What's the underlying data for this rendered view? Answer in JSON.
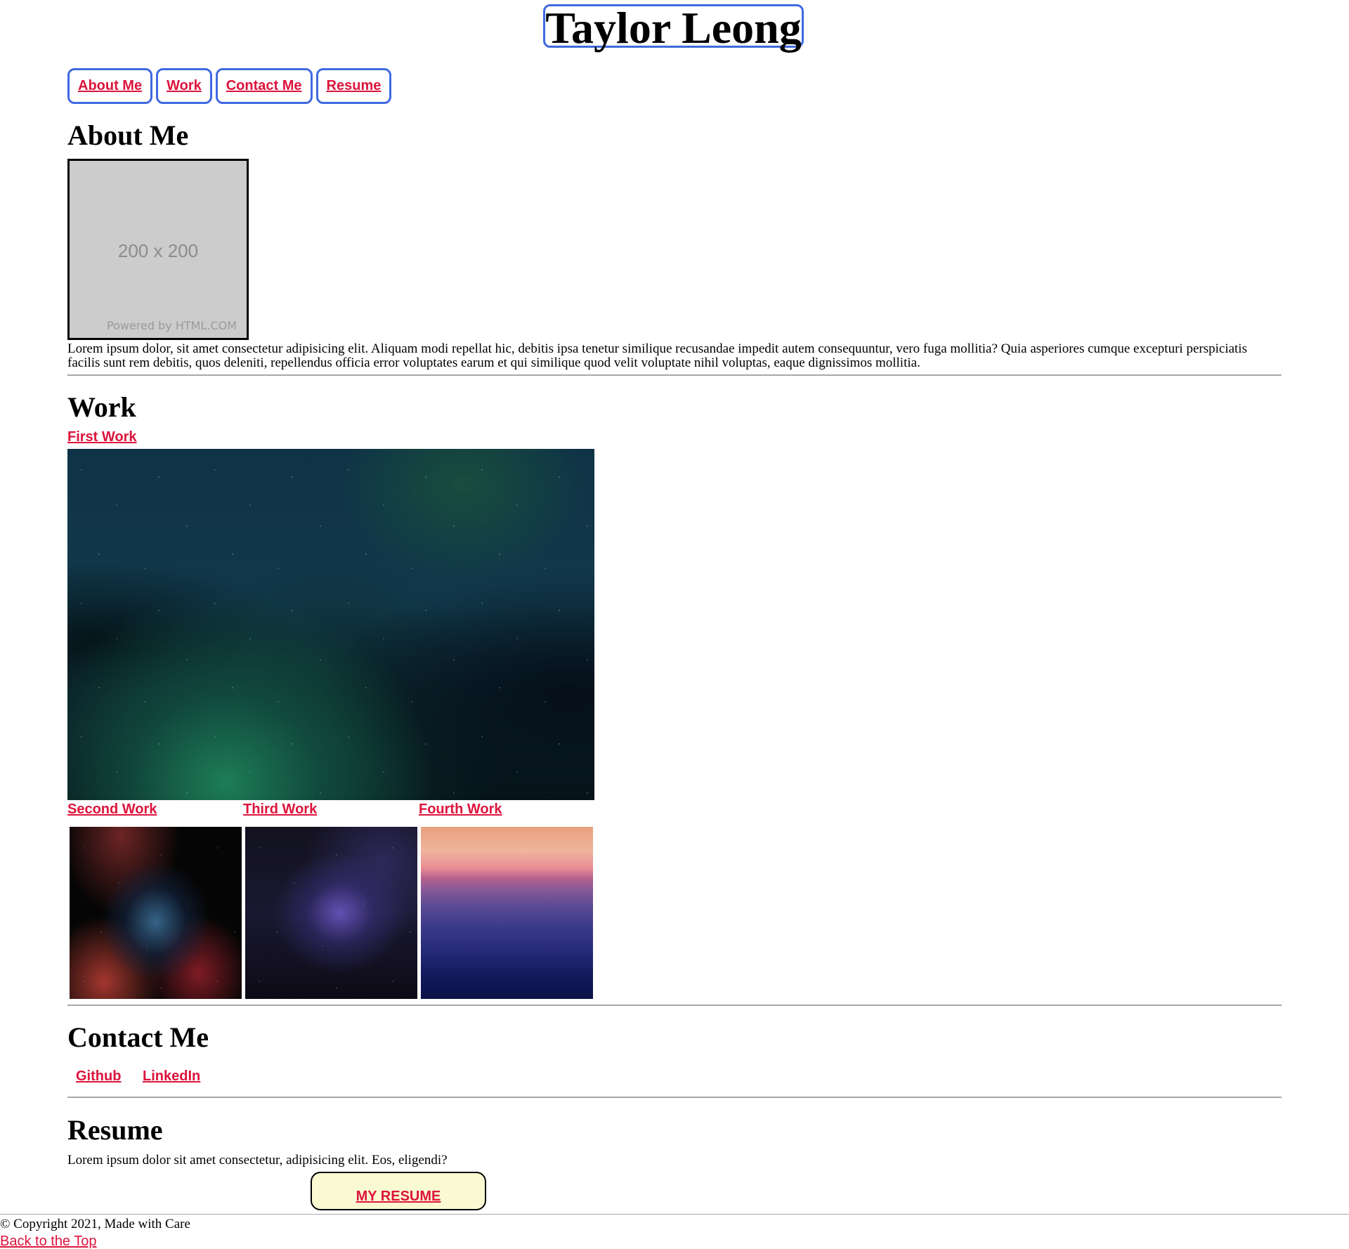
{
  "header": {
    "title": "Taylor Leong",
    "nav": [
      "About Me",
      "Work",
      "Contact Me",
      "Resume"
    ]
  },
  "about": {
    "title": "About Me",
    "photo_dims": "200 x 200",
    "photo_brand": "Powered by HTML.COM",
    "text": "Lorem ipsum dolor, sit amet consectetur adipisicing elit. Aliquam modi repellat hic, debitis ipsa tenetur similique recusandae impedit autem consequuntur, vero fuga mollitia? Quia asperiores cumque excepturi perspiciatis facilis sunt rem debitis, quos deleniti, repellendus officia error voluptates earum et qui similique quod velit voluptate nihil voluptas, eaque dignissimos mollitia."
  },
  "work": {
    "title": "Work",
    "items": [
      "First Work",
      "Second Work",
      "Third Work",
      "Fourth Work"
    ]
  },
  "contact": {
    "title": "Contact Me",
    "links": [
      "Github",
      "LinkedIn"
    ]
  },
  "resume": {
    "title": "Resume",
    "text": "Lorem ipsum dolor sit amet consectetur, adipisicing elit. Eos, eligendi?",
    "button": "MY RESUME"
  },
  "footer": {
    "copyright": "© Copyright 2021, Made with Care",
    "back_to_top": "Back to the Top"
  },
  "colors": {
    "link": "#dc143c",
    "nav_border": "#4169e1",
    "resume_button_bg": "#fafad2"
  }
}
